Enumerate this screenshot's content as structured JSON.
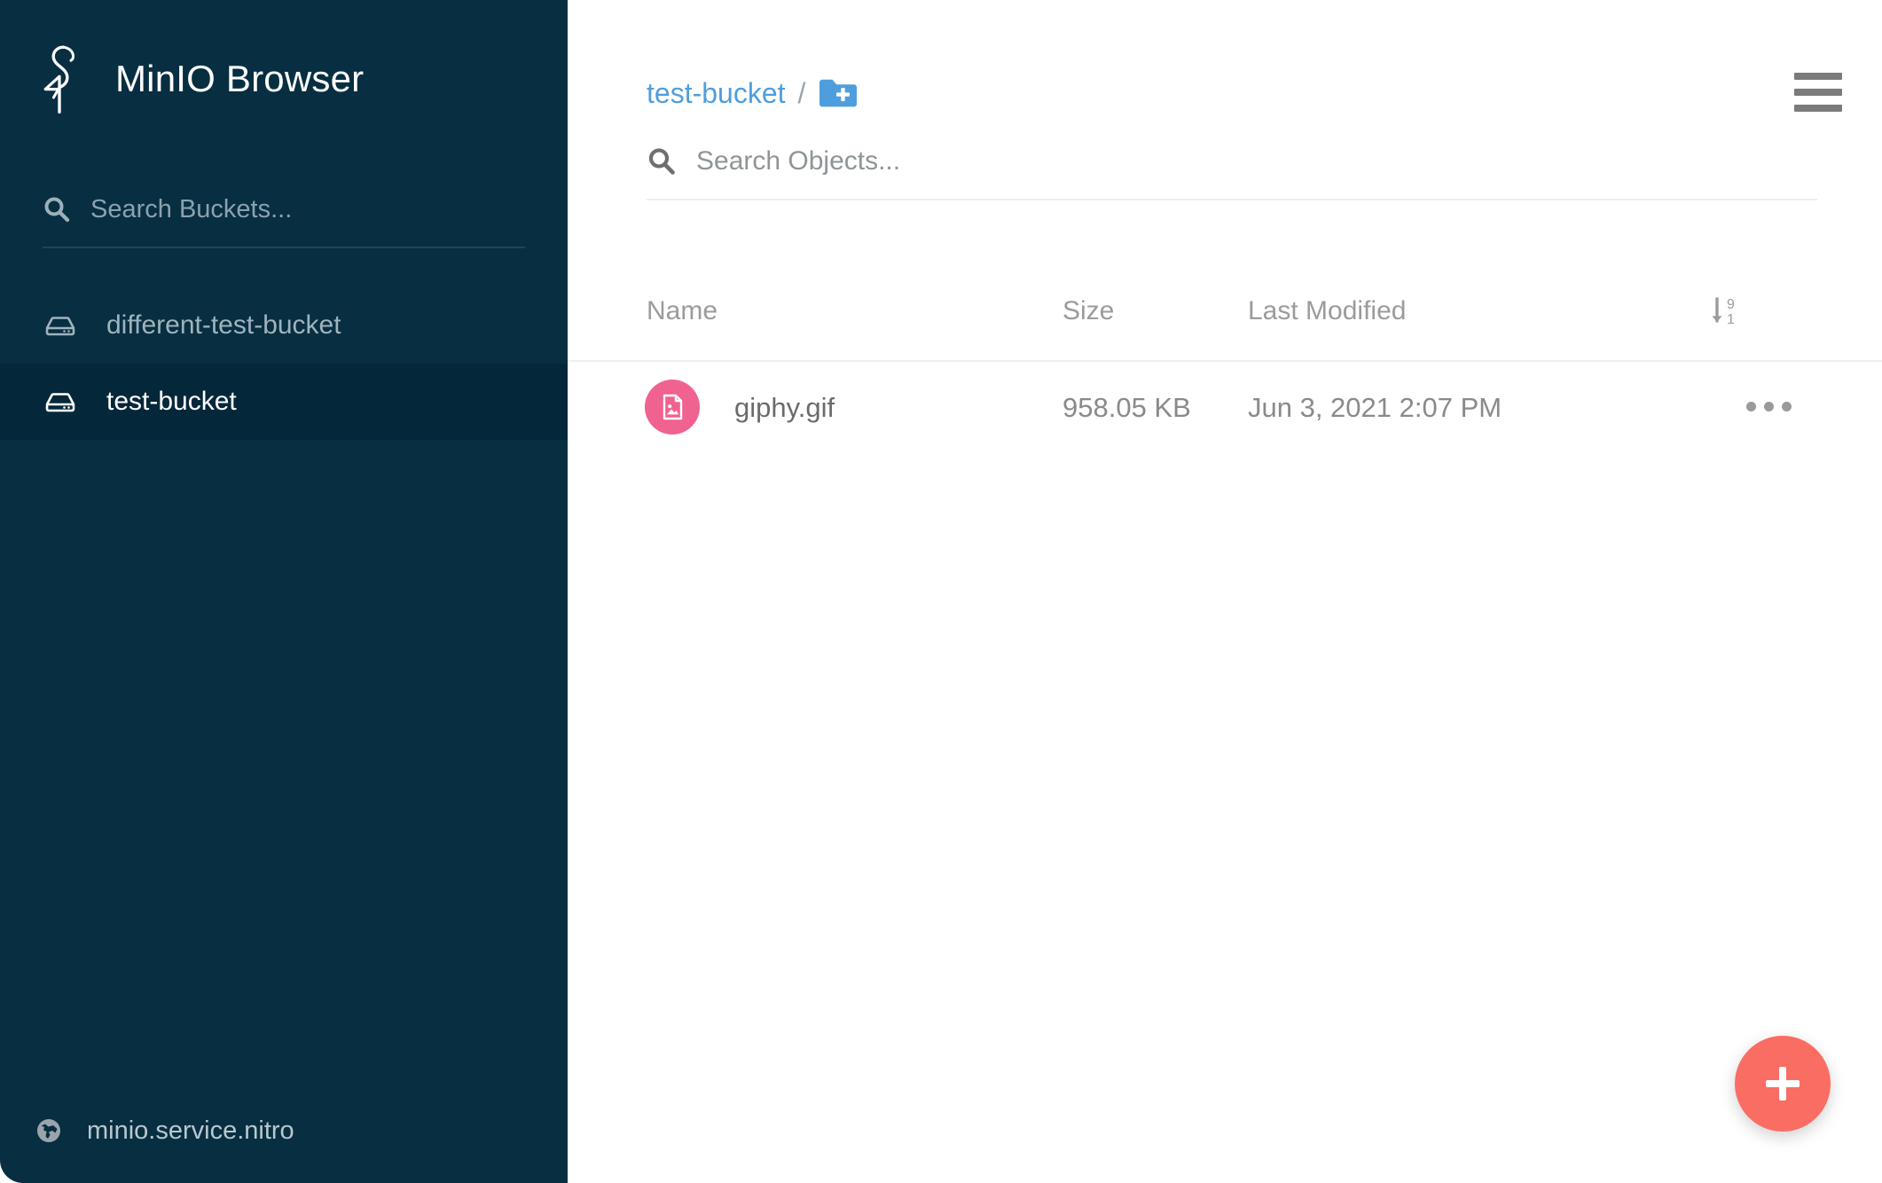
{
  "app": {
    "title": "MinIO Browser",
    "logo_icon": "minio-stork-logo"
  },
  "colors": {
    "sidebar_bg": "#072e41",
    "sidebar_active_bg": "#04273a",
    "accent_link": "#4e9ede",
    "folder_button": "#4e9ede",
    "file_icon_bg": "#f0628f",
    "fab_bg": "#fa6d63",
    "header_text": "#9b9b9b"
  },
  "sidebar": {
    "search": {
      "placeholder": "Search Buckets...",
      "value": "",
      "icon": "search-icon"
    },
    "buckets": [
      {
        "label": "different-test-bucket",
        "icon": "drive-icon",
        "active": false
      },
      {
        "label": "test-bucket",
        "icon": "drive-icon",
        "active": true
      }
    ],
    "host": {
      "label": "minio.service.nitro",
      "icon": "globe-icon"
    }
  },
  "main": {
    "breadcrumb": {
      "bucket": "test-bucket",
      "separator": "/",
      "create_folder_icon": "folder-plus-icon"
    },
    "menu_icon": "hamburger-menu-icon",
    "search": {
      "placeholder": "Search Objects...",
      "value": "",
      "icon": "search-icon"
    },
    "table": {
      "columns": {
        "name": "Name",
        "size": "Size",
        "modified": "Last Modified"
      },
      "sort_icon": "sort-descending-icon",
      "rows": [
        {
          "name": "giphy.gif",
          "size": "958.05 KB",
          "modified": "Jun 3, 2021 2:07 PM",
          "icon": "image-file-icon",
          "menu_icon": "more-options-icon"
        }
      ]
    },
    "fab": {
      "icon": "plus-icon",
      "label": "+"
    }
  }
}
